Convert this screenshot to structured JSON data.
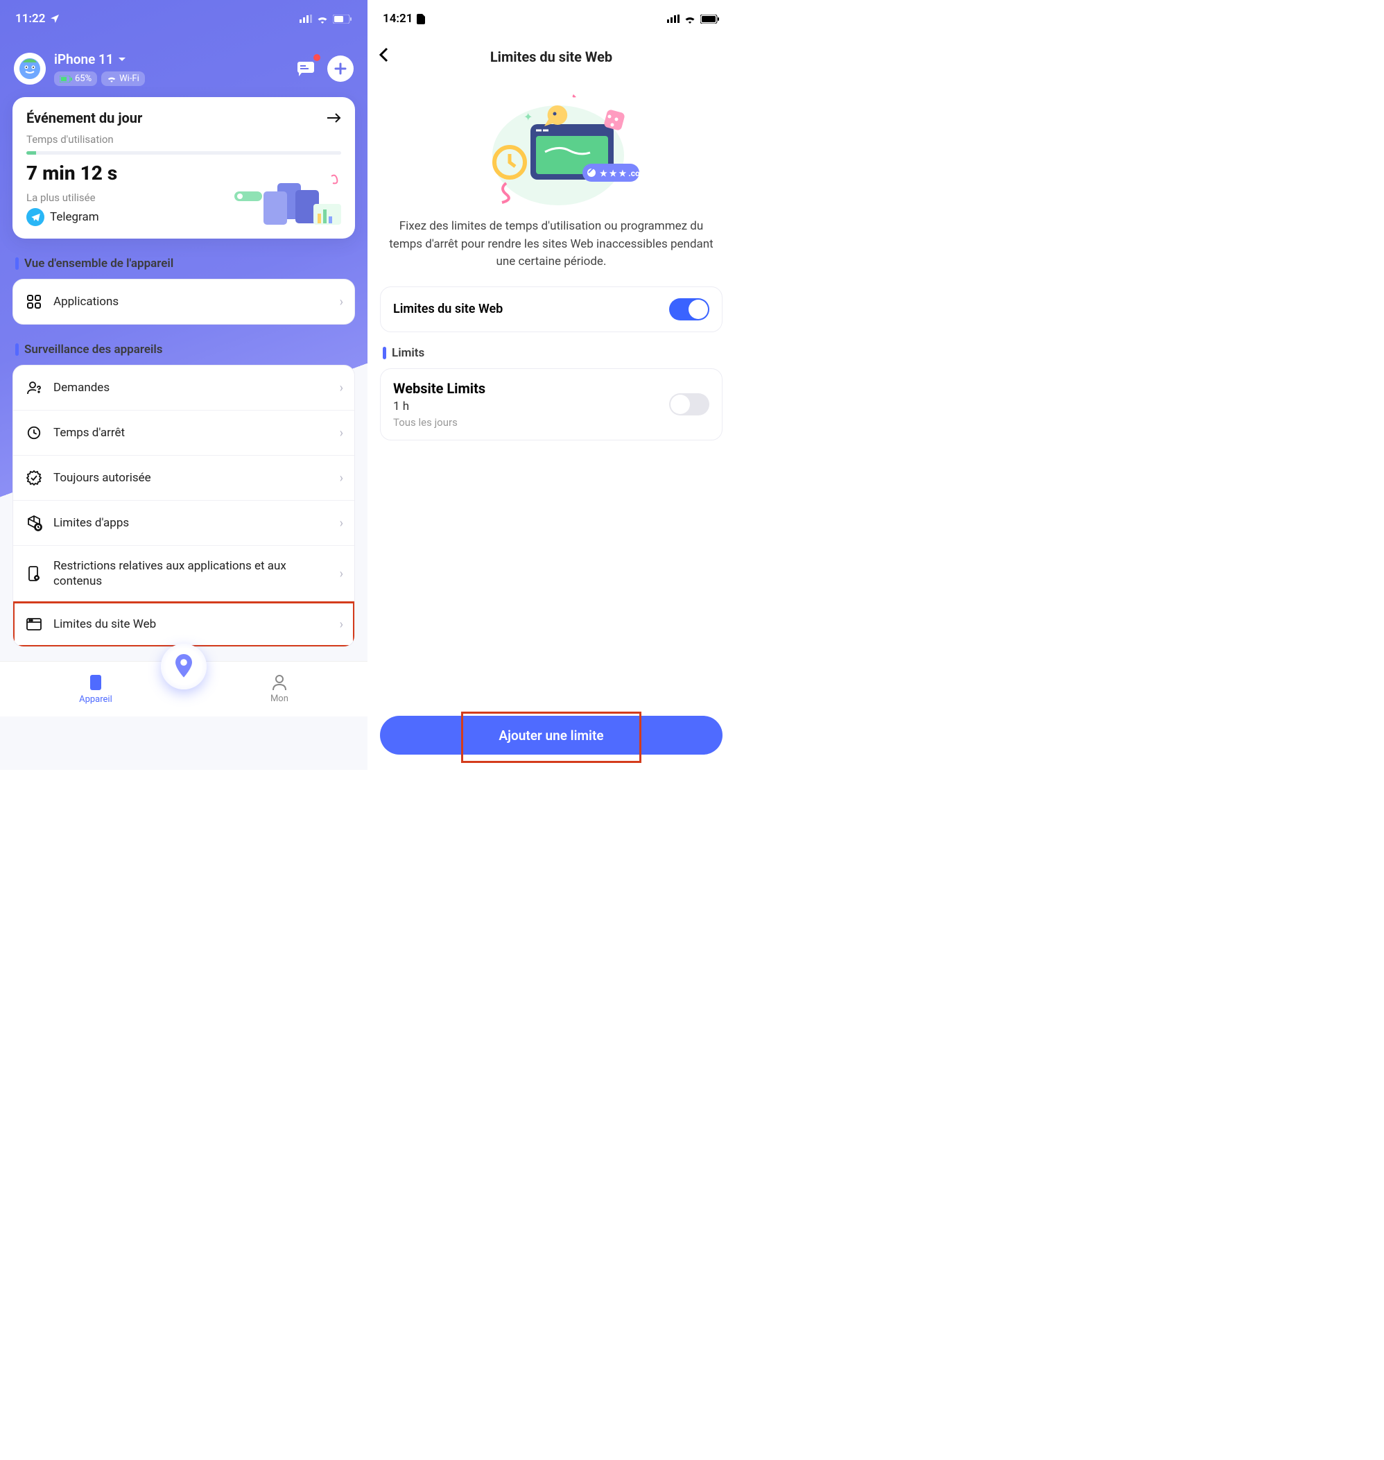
{
  "left": {
    "statusbar": {
      "time": "11:22"
    },
    "device_name": "iPhone 11",
    "battery": "65%",
    "wifi": "Wi-Fi",
    "card": {
      "title": "Événement du jour",
      "usage_label": "Temps d'utilisation",
      "usage_value": "7 min 12 s",
      "most_used_label": "La plus utilisée",
      "most_used_app": "Telegram"
    },
    "section_overview": "Vue d'ensemble de l'appareil",
    "apps_row": "Applications",
    "section_monitor": "Surveillance des appareils",
    "rows": {
      "requests": "Demandes",
      "downtime": "Temps d'arrêt",
      "always_allowed": "Toujours autorisée",
      "app_limits": "Limites d'apps",
      "content_restrictions": "Restrictions relatives aux applications et aux contenus",
      "website_limits": "Limites du site Web"
    },
    "tabs": {
      "device": "Appareil",
      "mine": "Mon"
    }
  },
  "right": {
    "statusbar": {
      "time": "14:21"
    },
    "title": "Limites du site Web",
    "description": "Fixez des limites de temps d'utilisation ou programmez du temps d'arrêt pour rendre les sites Web inaccessibles pendant une certaine période.",
    "toggle_label": "Limites du site Web",
    "limits_header": "Limits",
    "limit": {
      "title": "Website Limits",
      "duration": "1 h",
      "schedule": "Tous les jours"
    },
    "cta": "Ajouter une limite"
  }
}
